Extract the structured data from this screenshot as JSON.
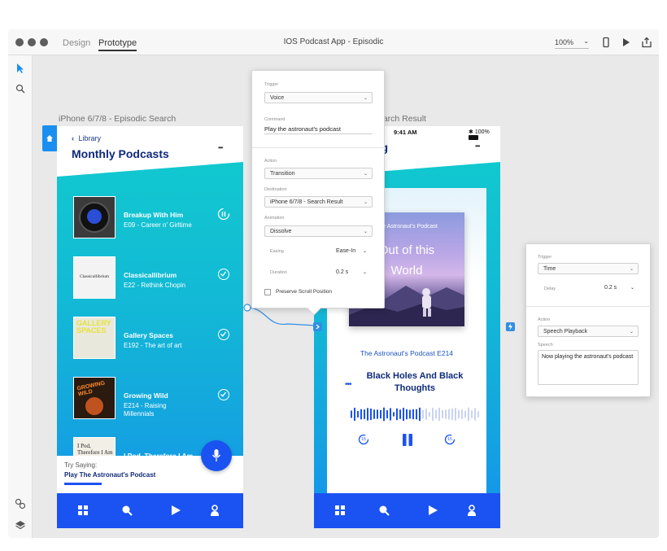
{
  "app": {
    "modes": [
      "Design",
      "Prototype"
    ],
    "active_mode": "Prototype",
    "doc_title": "IOS Podcast App - Episodic",
    "zoom": "100%"
  },
  "artboards": {
    "left_label": "iPhone 6/7/8 - Episodic Search",
    "right_label": "earch Result"
  },
  "left_phone": {
    "back_label": "Library",
    "title": "Monthly Podcasts",
    "more": "•••",
    "items": [
      {
        "title": "Breakup With Him",
        "sub": "E09 - Career n' Girltime"
      },
      {
        "title": "Classicallibrium",
        "sub": "E22 - Rethink Chopin"
      },
      {
        "title": "Gallery Spaces",
        "sub": "E192 - The art of art"
      },
      {
        "title": "Growing Wild",
        "sub": "E214 - Raising Millennials"
      },
      {
        "title": "I Pod, Therefore I Am",
        "sub": ""
      }
    ],
    "thumb_texts": {
      "classic": "Classicallibrium",
      "gallery": "GALLERY SPACES",
      "growing": "GROWING WILD",
      "ipod": "I Pod, Therefore I Am"
    },
    "try_saying_label": "Try Saying:",
    "try_saying_phrase": "Play The Astronaut's Podcast"
  },
  "right_phone": {
    "time": "9:41 AM",
    "battery": "100%",
    "header_fragment": "ing",
    "more": "•••",
    "cover_title": "The Astronaut's Podcast",
    "cover_headline": "Out of this World",
    "episode": "The Astronaut's Podcast E214",
    "track_title": "Black Holes And Black Thoughts",
    "skip_back": "15",
    "skip_fwd": "15",
    "waveform_played_fraction": 0.55
  },
  "popover_main": {
    "trigger_label": "Trigger",
    "trigger_value": "Voice",
    "command_label": "Command",
    "command_value": "Play the astronaut's podcast",
    "action_label": "Action",
    "action_value": "Transition",
    "destination_label": "Destination",
    "destination_value": "iPhone 6/7/8 - Search Result",
    "animation_label": "Animation",
    "animation_value": "Dissolve",
    "easing_label": "Easing",
    "easing_value": "Ease-In",
    "duration_label": "Duration",
    "duration_value": "0.2 s",
    "preserve_label": "Preserve Scroll Position"
  },
  "popover_side": {
    "trigger_label": "Trigger",
    "trigger_value": "Time",
    "delay_label": "Delay",
    "delay_value": "0.2 s",
    "action_label": "Action",
    "action_value": "Speech Playback",
    "speech_label": "Speech",
    "speech_value": "Now playing the astronaut's podcast"
  },
  "colors": {
    "accent_blue": "#1b53f2",
    "teal": "#11c8cf",
    "connector": "#2f8fe6"
  }
}
